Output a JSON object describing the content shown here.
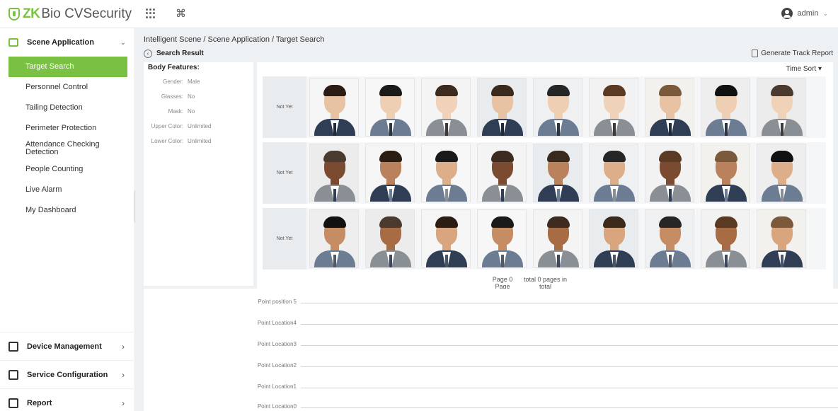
{
  "app": {
    "logo_zk": "ZK",
    "logo_rest": "Bio CVSecurity",
    "cmd_symbol": "⌘"
  },
  "user": {
    "name": "admin",
    "chevron": "⌄"
  },
  "sidebar": {
    "head": {
      "label": "Scene Application",
      "chevron": "⌄"
    },
    "items": [
      {
        "label": "Target Search",
        "active": true
      },
      {
        "label": "Personnel Control"
      },
      {
        "label": "Tailing Detection"
      },
      {
        "label": "Perimeter Protection"
      },
      {
        "label": "Attendance Checking Detection"
      },
      {
        "label": "People Counting"
      },
      {
        "label": "Live Alarm"
      },
      {
        "label": "My Dashboard"
      }
    ],
    "bottom": [
      {
        "label": "Device Management",
        "chevron": "›"
      },
      {
        "label": "Service Configuration",
        "chevron": "›"
      },
      {
        "label": "Report",
        "chevron": "›"
      }
    ],
    "collapse_symbol": "«"
  },
  "breadcrumb": "Intelligent Scene / Scene Application / Target Search",
  "search_result": {
    "title": "Search Result",
    "back_symbol": "‹",
    "generate_label": "Generate Track Report"
  },
  "features": {
    "title": "Body Features:",
    "rows": [
      {
        "key": "Gender:",
        "value": "Male"
      },
      {
        "key": "Glasses:",
        "value": "No"
      },
      {
        "key": "Mask:",
        "value": "No"
      },
      {
        "key": "Upper Color:",
        "value": "Unlimited"
      },
      {
        "key": "Lower Color:",
        "value": "Unlimited"
      }
    ]
  },
  "results": {
    "sort_label": "Time Sort",
    "sort_chevron": "▾",
    "rows": [
      {
        "label": "Not Yet"
      },
      {
        "label": "Not Yet"
      },
      {
        "label": "Not Yet"
      }
    ],
    "pager": {
      "page_text": "Page 0 Page",
      "total_text": "total 0 pages in total"
    }
  },
  "timeline": {
    "labels": [
      "Point position 5",
      "Point Location4",
      "Point Location3",
      "Point Location2",
      "Point Location1",
      "Point Location0"
    ]
  }
}
